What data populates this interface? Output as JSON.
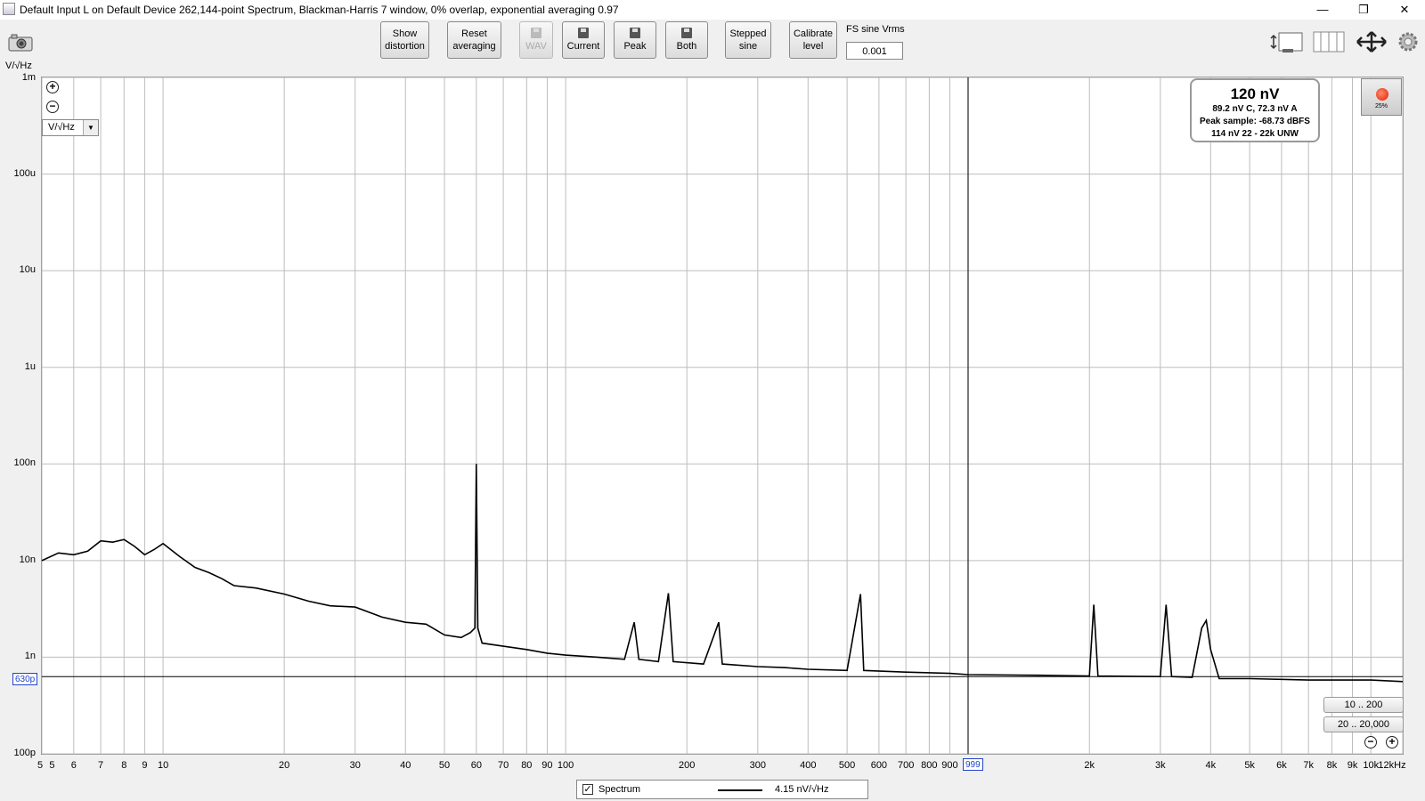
{
  "window": {
    "title": "Default Input L on Default Device 262,144-point Spectrum, Blackman-Harris 7 window, 0% overlap, exponential averaging 0.97",
    "minimize": "—",
    "restore": "❐",
    "close": "✕"
  },
  "toolbar": {
    "show_distortion": [
      "Show",
      "distortion"
    ],
    "reset_averaging": [
      "Reset",
      "averaging"
    ],
    "wav": "WAV",
    "current": "Current",
    "peak": "Peak",
    "both": "Both",
    "stepped_sine": [
      "Stepped",
      "sine"
    ],
    "calibrate_level": [
      "Calibrate",
      "level"
    ],
    "fs_label": "FS sine Vrms",
    "fs_value": "0.001"
  },
  "plot": {
    "y_unit_label": "V/√Hz",
    "unit_select": "V/√Hz",
    "zoom_in": "+",
    "zoom_out": "−",
    "marker_y_label": "630p",
    "marker_x_label": "999",
    "readout": {
      "main": "120 nV",
      "line1": "89.2 nV C, 72.3 nV A",
      "line2": "Peak sample: -68.73 dBFS",
      "line3": "114 nV 22 - 22k UNW"
    },
    "record_pct": "25%",
    "range_buttons": [
      "10 .. 200",
      "20 .. 20,000"
    ],
    "legend": {
      "checked": "✓",
      "name": "Spectrum",
      "value": "4.15 nV/√Hz"
    }
  },
  "colors": {
    "plot_bg": "#ffffff",
    "grid": "#b0b0b0",
    "trace": "#000000",
    "marker_label": "#2244cc"
  },
  "chart_data": {
    "type": "line",
    "title": "",
    "xlabel": "",
    "ylabel": "V/√Hz",
    "x_scale": "log",
    "y_scale": "log",
    "xlim": [
      5,
      12000
    ],
    "ylim": [
      1e-10,
      0.001
    ],
    "x_tick_labels": [
      "5",
      "5",
      "6",
      "7",
      "8",
      "9",
      "10",
      "20",
      "30",
      "40",
      "50",
      "60",
      "70",
      "80",
      "90",
      "100",
      "200",
      "300",
      "400",
      "500",
      "600",
      "700",
      "800",
      "900",
      "999",
      "2k",
      "3k",
      "4k",
      "5k",
      "6k",
      "7k",
      "8k",
      "9k",
      "10k",
      "12kHz"
    ],
    "y_tick_labels": [
      "1m",
      "100u",
      "10u",
      "1u",
      "100n",
      "10n",
      "1n",
      "630p",
      "100p"
    ],
    "grid": true,
    "legend_position": "bottom-center",
    "marker_y": 6.3e-10,
    "marker_x": 999,
    "series": [
      {
        "name": "Spectrum",
        "points": [
          [
            5,
            1e-08
          ],
          [
            5.5,
            1.2e-08
          ],
          [
            6,
            1.15e-08
          ],
          [
            6.5,
            1.25e-08
          ],
          [
            7,
            1.6e-08
          ],
          [
            7.5,
            1.55e-08
          ],
          [
            8,
            1.65e-08
          ],
          [
            8.5,
            1.4e-08
          ],
          [
            9,
            1.15e-08
          ],
          [
            9.5,
            1.3e-08
          ],
          [
            10,
            1.5e-08
          ],
          [
            11,
            1.1e-08
          ],
          [
            12,
            8.5e-09
          ],
          [
            13,
            7.5e-09
          ],
          [
            14,
            6.5e-09
          ],
          [
            15,
            5.5e-09
          ],
          [
            17,
            5.2e-09
          ],
          [
            20,
            4.5e-09
          ],
          [
            23,
            3.8e-09
          ],
          [
            26,
            3.4e-09
          ],
          [
            30,
            3.3e-09
          ],
          [
            35,
            2.6e-09
          ],
          [
            40,
            2.3e-09
          ],
          [
            45,
            2.2e-09
          ],
          [
            50,
            1.7e-09
          ],
          [
            55,
            1.6e-09
          ],
          [
            58,
            1.8e-09
          ],
          [
            59.5,
            2e-09
          ],
          [
            60,
            1e-07
          ],
          [
            60.5,
            2e-09
          ],
          [
            62,
            1.4e-09
          ],
          [
            70,
            1.3e-09
          ],
          [
            80,
            1.2e-09
          ],
          [
            90,
            1.1e-09
          ],
          [
            100,
            1.05e-09
          ],
          [
            120,
            1e-09
          ],
          [
            140,
            9.5e-10
          ],
          [
            148,
            2.3e-09
          ],
          [
            152,
            9.5e-10
          ],
          [
            170,
            9e-10
          ],
          [
            180,
            4.6e-09
          ],
          [
            185,
            9e-10
          ],
          [
            220,
            8.5e-10
          ],
          [
            240,
            2.3e-09
          ],
          [
            245,
            8.5e-10
          ],
          [
            300,
            8e-10
          ],
          [
            350,
            7.8e-10
          ],
          [
            400,
            7.5e-10
          ],
          [
            500,
            7.3e-10
          ],
          [
            540,
            4.5e-09
          ],
          [
            550,
            7.3e-10
          ],
          [
            700,
            7e-10
          ],
          [
            900,
            6.8e-10
          ],
          [
            1000,
            6.6e-10
          ],
          [
            1500,
            6.5e-10
          ],
          [
            2000,
            6.4e-10
          ],
          [
            2050,
            3.5e-09
          ],
          [
            2100,
            6.4e-10
          ],
          [
            3000,
            6.3e-10
          ],
          [
            3100,
            3.5e-09
          ],
          [
            3200,
            6.3e-10
          ],
          [
            3600,
            6.2e-10
          ],
          [
            3800,
            2e-09
          ],
          [
            3900,
            2.4e-09
          ],
          [
            4000,
            1.2e-09
          ],
          [
            4200,
            6e-10
          ],
          [
            5000,
            6e-10
          ],
          [
            7000,
            5.8e-10
          ],
          [
            10000,
            5.8e-10
          ],
          [
            12000,
            5.6e-10
          ]
        ]
      }
    ]
  }
}
